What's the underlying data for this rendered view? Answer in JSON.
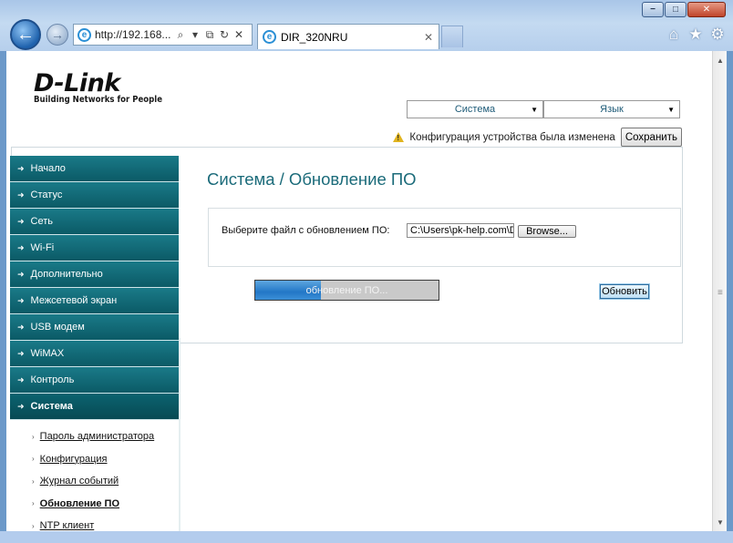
{
  "browser": {
    "address_url": "http://192.168...",
    "tab_title": "DIR_320NRU",
    "tools": {
      "search": "⌕",
      "dropdown": "▾",
      "compat": "⧉",
      "refresh": "↻",
      "stop": "✕"
    },
    "window_buttons": {
      "minimize": "−",
      "maximize": "□",
      "close": "✕"
    },
    "icons": {
      "home": "⌂",
      "favorites": "★",
      "settings": "⚙",
      "back": "←",
      "forward": "→",
      "tab_close": "✕"
    }
  },
  "header": {
    "logo_text": "D-Link",
    "logo_tagline": "Building Networks for People",
    "system_select": "Система",
    "language_select": "Язык",
    "warning_text": "Конфигурация устройства была изменена",
    "save_label": "Сохранить"
  },
  "sidebar": {
    "items": [
      {
        "label": "Начало"
      },
      {
        "label": "Статус"
      },
      {
        "label": "Сеть"
      },
      {
        "label": "Wi-Fi"
      },
      {
        "label": "Дополнительно"
      },
      {
        "label": "Межсетевой экран"
      },
      {
        "label": "USB модем"
      },
      {
        "label": "WiMAX"
      },
      {
        "label": "Контроль"
      },
      {
        "label": "Система"
      }
    ],
    "submenu": [
      {
        "label": "Пароль администратора"
      },
      {
        "label": "Конфигурация"
      },
      {
        "label": "Журнал событий"
      },
      {
        "label": "Обновление ПО"
      },
      {
        "label": "NTP клиент"
      }
    ]
  },
  "main": {
    "title": "Система  /  Обновление ПО",
    "file_label": "Выберите файл с обновлением ПО:",
    "file_path": "C:\\Users\\pk-help.com\\De",
    "browse_label": "Browse...",
    "progress_text": "обновление ПО...",
    "progress_fraction": 0.36,
    "update_label": "Обновить"
  },
  "colors": {
    "accent": "#1b6b7a",
    "sidebar_bg": "#0f6c78",
    "progress_fill": "#2277c7",
    "warning": "#e1b41f"
  }
}
